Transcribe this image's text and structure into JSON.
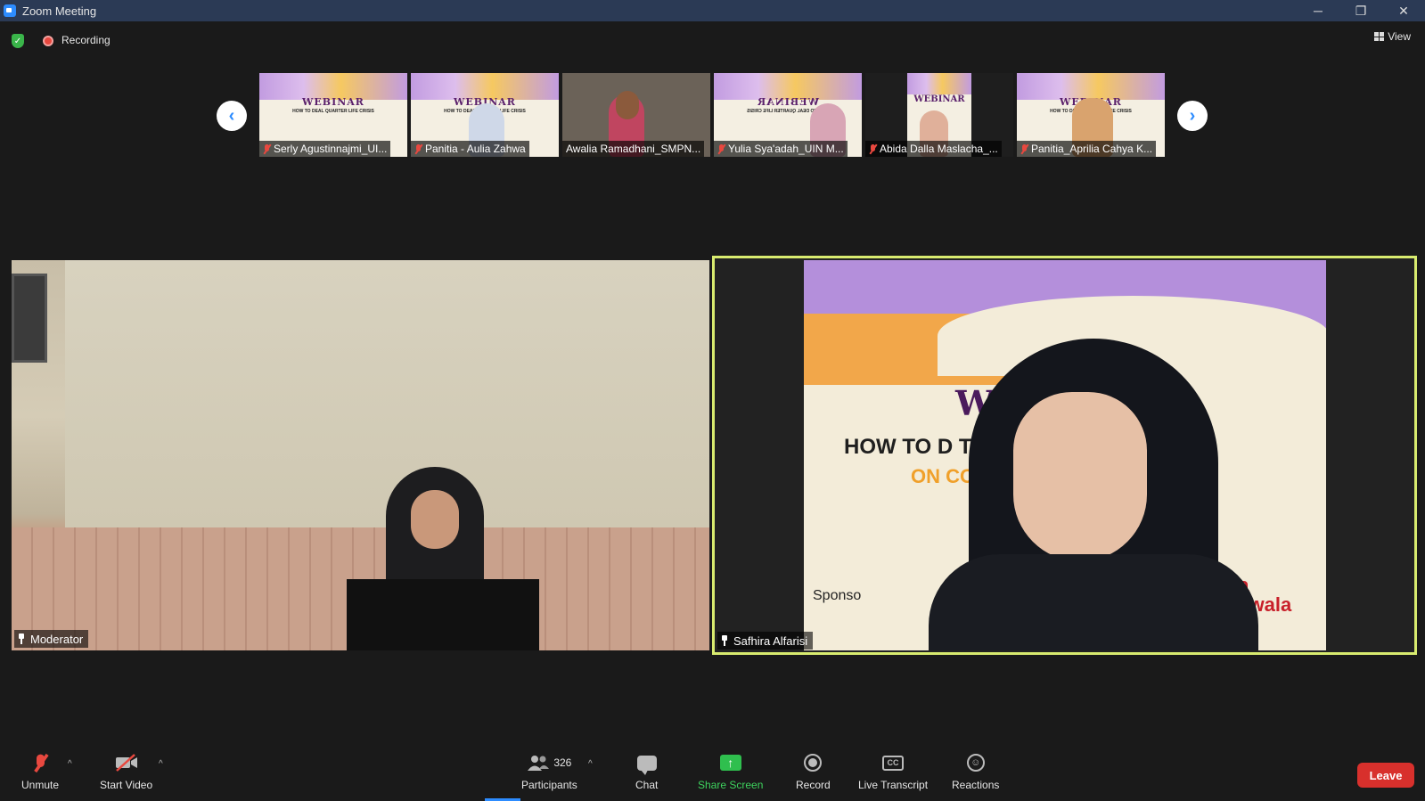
{
  "window": {
    "title": "Zoom Meeting",
    "minimize": "─",
    "restore": "❐",
    "close": "✕"
  },
  "topbar": {
    "recording_label": "Recording",
    "view_label": "View"
  },
  "gallery": {
    "prev_arrow": "‹",
    "next_arrow": "›",
    "thumbnails": [
      {
        "name": "Serly Agustinnajmi_UI...",
        "muted": true,
        "type": "slide",
        "slide_title": "WEBINAR",
        "slide_sub": "HOW TO DEAL QUARTER LIFE CRISIS"
      },
      {
        "name": "Panitia - Aulia Zahwa",
        "muted": true,
        "type": "slide",
        "slide_title": "WEBINAR",
        "slide_sub": "HOW TO DEAL QUARTER LIFE CRISIS"
      },
      {
        "name": "Awalia Ramadhani_SMPN...",
        "muted": false,
        "type": "photo"
      },
      {
        "name": "Yulia Sya'adah_UIN M...",
        "muted": true,
        "type": "slide",
        "slide_title": "WEBINAR",
        "slide_sub": "HOW TO DEAL QUARTER LIFE CRISIS"
      },
      {
        "name": "Abida Dalla Maslacha_...",
        "muted": true,
        "type": "slide",
        "slide_title": "WEBINAR",
        "slide_sub": "HOW TO DEAL QUARTER LIFE CRISIS"
      },
      {
        "name": "Panitia_Aprilia Cahya K...",
        "muted": true,
        "type": "slide",
        "slide_title": "WEBINAR",
        "slide_sub": "HOW TO DEAL QUARTER LIFE CRISIS"
      }
    ]
  },
  "main": {
    "left_tile": {
      "name": "Moderator"
    },
    "right_tile": {
      "name": "Safhira Alfarisi",
      "slide_title": "W      NAR",
      "slide_line2": "HOW TO D           TER LIFE CRISIS",
      "slide_line3": "ON                COVID-19",
      "sponsor": "Sponso",
      "brand": "warta cakrawala"
    }
  },
  "toolbar": {
    "unmute": "Unmute",
    "start_video": "Start Video",
    "participants": "Participants",
    "participant_count": "326",
    "chat": "Chat",
    "share_screen": "Share Screen",
    "record": "Record",
    "live_transcript": "Live Transcript",
    "live_transcript_icon": "CC",
    "reactions": "Reactions",
    "leave": "Leave",
    "caret": "^"
  },
  "colors": {
    "accent": "#2d8cff",
    "share_green": "#2fbf4e",
    "leave_red": "#d8302c",
    "active_speaker_border": "#d8eb6f"
  }
}
